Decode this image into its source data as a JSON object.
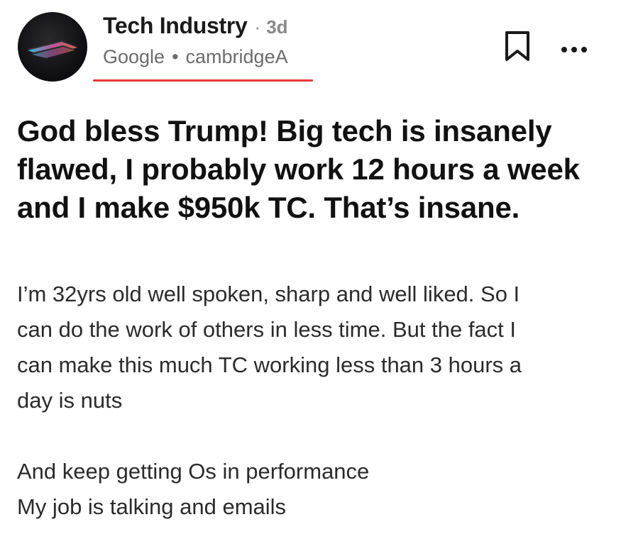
{
  "channel": {
    "name": "Tech Industry",
    "separator": "·",
    "age": "3d"
  },
  "author": {
    "company": "Google",
    "separator": "•",
    "username": "cambridgeA"
  },
  "accent_colors": {
    "underline": "#e53935",
    "meta_gray": "#8a8a8a"
  },
  "icons": {
    "bookmark": "bookmark-icon",
    "more": "more-options-icon",
    "avatar": "laptop-avatar"
  },
  "post": {
    "title": "God bless Trump! Big tech is insanely flawed, I probably work 12 hours a week and I make $950k TC. That’s insane.",
    "paragraphs": [
      "I’m 32yrs old well spoken, sharp and well liked. So I can do the work of others in less time. But the fact I can make this much TC working less than 3 hours a day is nuts",
      "And keep getting Os in performance\nMy job is talking and emails"
    ],
    "paragraph_lines": [
      [
        "I’m 32yrs old well spoken, sharp and well liked. So I",
        "can do the work of others in less time. But the fact I",
        "can make this much TC working less than 3 hours a",
        "day is nuts"
      ],
      [
        "And keep getting Os in performance",
        "My job is talking and emails"
      ]
    ]
  }
}
